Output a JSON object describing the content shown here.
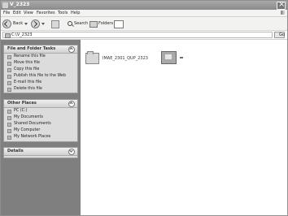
{
  "window": {
    "title": "V_2323"
  },
  "menu": [
    "File",
    "Edit",
    "View",
    "Favorites",
    "Tools",
    "Help"
  ],
  "toolbar": {
    "back": "Back",
    "search": "Search",
    "folders": "Folders"
  },
  "address": {
    "value": "C:\\V_2323",
    "go": "Go"
  },
  "left_pane": {
    "file_folder_tasks": {
      "title": "File and Folder Tasks",
      "items": [
        "Rename this file",
        "Move this file",
        "Copy this file",
        "Publish this file to the Web",
        "E-mail this file",
        "Delete this file"
      ]
    },
    "other_places": {
      "title": "Other Places",
      "items": [
        "PC (C:)",
        "My Documents",
        "Shared Documents",
        "My Computer",
        "My Network Places"
      ]
    },
    "details": {
      "title": "Details"
    }
  },
  "files": [
    {
      "name": "IMAE_2301_QUP_2323",
      "type": "folder"
    },
    {
      "name": "",
      "type": "file",
      "selected": true
    }
  ]
}
